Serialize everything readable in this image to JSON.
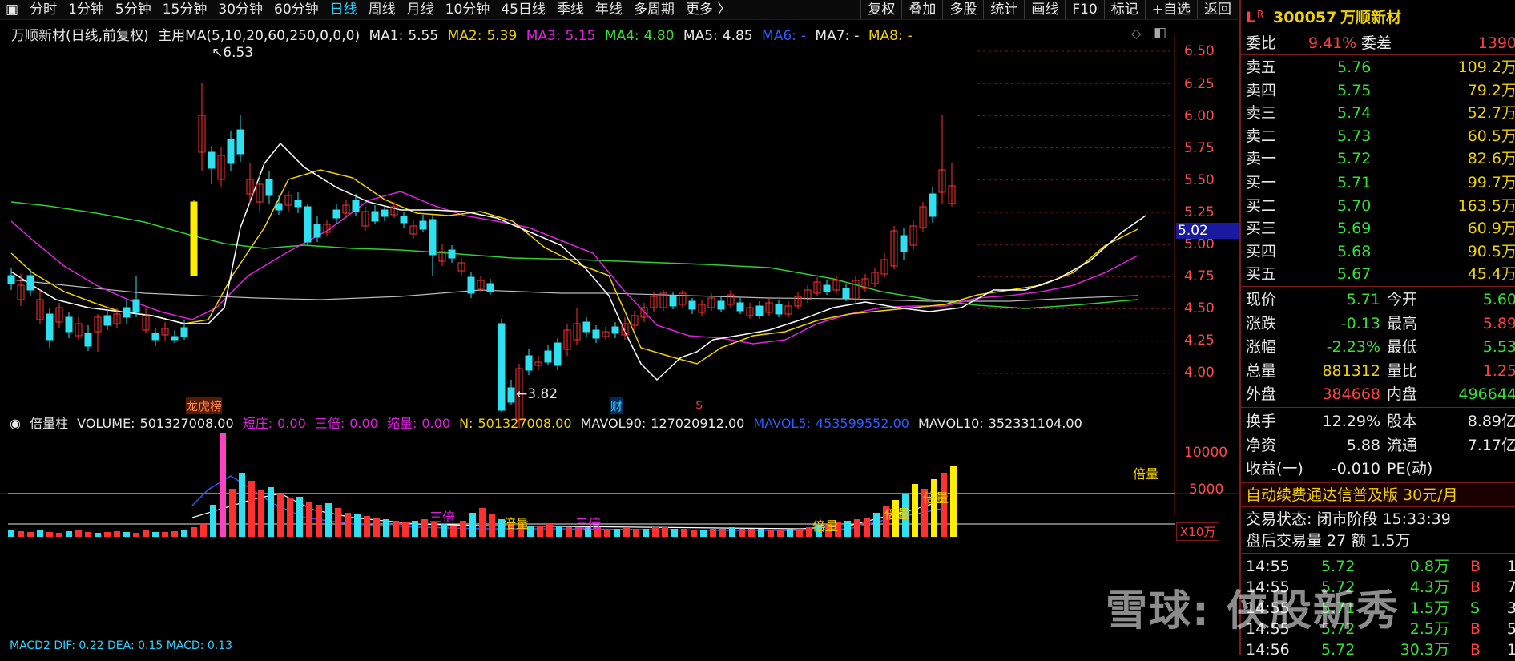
{
  "toolbar": {
    "periods": [
      "分时",
      "1分钟",
      "5分钟",
      "15分钟",
      "30分钟",
      "60分钟",
      "日线",
      "周线",
      "月线",
      "10分钟",
      "45日线",
      "季线",
      "年线",
      "多周期",
      "更多 〉"
    ],
    "active": "日线",
    "right_buttons": [
      "复权",
      "叠加",
      "多股",
      "统计",
      "画线",
      "F10",
      "标记",
      "+自选",
      "返回"
    ]
  },
  "main_header": {
    "stock_mode": "万顺新材(日线,前复权)",
    "indicator_name": "主用MA(5,10,20,60,250,0,0,0)",
    "ma": [
      {
        "label": "MA1:",
        "value": "5.55",
        "color": "#e8e8e8"
      },
      {
        "label": "MA2:",
        "value": "5.39",
        "color": "#f0d000"
      },
      {
        "label": "MA3:",
        "value": "5.15",
        "color": "#e020e0"
      },
      {
        "label": "MA4:",
        "value": "4.80",
        "color": "#35e035"
      },
      {
        "label": "MA5:",
        "value": "4.85",
        "color": "#e8e8e8"
      },
      {
        "label": "MA6:",
        "value": "-",
        "color": "#2a5cff"
      },
      {
        "label": "MA7:",
        "value": "-",
        "color": "#e8e8e8"
      },
      {
        "label": "MA8:",
        "value": "-",
        "color": "#f0d000"
      }
    ]
  },
  "price_axis": [
    "6.50",
    "6.25",
    "6.00",
    "5.75",
    "5.50",
    "5.25",
    "5.00",
    "4.75",
    "4.50",
    "4.25",
    "4.00"
  ],
  "current_price_tag": "5.02",
  "annotations": {
    "high": "6.53",
    "low": "3.82",
    "markers": [
      "龙虎榜",
      "财",
      "$"
    ]
  },
  "volume_header": {
    "name": "倍量柱",
    "items": [
      {
        "label": "VOLUME:",
        "value": "501327008.00",
        "color": "#e8e8e8"
      },
      {
        "label": "短庄:",
        "value": "0.00",
        "color": "#e020e0"
      },
      {
        "label": "三倍:",
        "value": "0.00",
        "color": "#e020e0"
      },
      {
        "label": "缩量:",
        "value": "0.00",
        "color": "#e020e0"
      },
      {
        "label": "N:",
        "value": "501327008.00",
        "color": "#f0d000"
      },
      {
        "label": "MAVOL90:",
        "value": "127020912.00",
        "color": "#e8e8e8"
      },
      {
        "label": "MAVOL5:",
        "value": "453599552.00",
        "color": "#2a5cff"
      },
      {
        "label": "MAVOL10:",
        "value": "352331104.00",
        "color": "#e8e8e8"
      }
    ]
  },
  "volume_axis": [
    "10000",
    "5000"
  ],
  "volume_unit": "X10万",
  "volume_labels": [
    "倍量",
    "三倍",
    "倍量",
    "三倍",
    "倍量",
    "倍量",
    "倍量"
  ],
  "macd_header": "MACD2 DIF: 0.22 DEA: 0.15 MACD: 0.13",
  "quote": {
    "title_prefix": "L",
    "title_sup": "R",
    "code": "300057",
    "name": "万顺新材",
    "weibi_label": "委比",
    "weibi": "9.41%",
    "weicha_label": "委差",
    "weicha": "1390",
    "asks": [
      {
        "label": "卖五",
        "price": "5.76",
        "vol": "109.2万"
      },
      {
        "label": "卖四",
        "price": "5.75",
        "vol": "79.2万"
      },
      {
        "label": "卖三",
        "price": "5.74",
        "vol": "52.7万"
      },
      {
        "label": "卖二",
        "price": "5.73",
        "vol": "60.5万"
      },
      {
        "label": "卖一",
        "price": "5.72",
        "vol": "82.6万"
      }
    ],
    "bids": [
      {
        "label": "买一",
        "price": "5.71",
        "vol": "99.7万"
      },
      {
        "label": "买二",
        "price": "5.70",
        "vol": "163.5万"
      },
      {
        "label": "买三",
        "price": "5.69",
        "vol": "60.9万"
      },
      {
        "label": "买四",
        "price": "5.68",
        "vol": "90.5万"
      },
      {
        "label": "买五",
        "price": "5.67",
        "vol": "45.4万"
      }
    ],
    "stats": [
      {
        "l1": "现价",
        "v1": "5.71",
        "c1": "green",
        "l2": "今开",
        "v2": "5.60",
        "c2": "green"
      },
      {
        "l1": "涨跌",
        "v1": "-0.13",
        "c1": "green",
        "l2": "最高",
        "v2": "5.89",
        "c2": "red"
      },
      {
        "l1": "涨幅",
        "v1": "-2.23%",
        "c1": "green",
        "l2": "最低",
        "v2": "5.53",
        "c2": "green"
      },
      {
        "l1": "总量",
        "v1": "881312",
        "c1": "yellow",
        "l2": "量比",
        "v2": "1.25",
        "c2": "red"
      },
      {
        "l1": "外盘",
        "v1": "384668",
        "c1": "red",
        "l2": "内盘",
        "v2": "496644",
        "c2": "green"
      }
    ],
    "stats2": [
      {
        "l1": "换手",
        "v1": "12.29%",
        "c1": "white",
        "l2": "股本",
        "v2": "8.89亿",
        "c2": "white"
      },
      {
        "l1": "净资",
        "v1": "5.88",
        "c1": "white",
        "l2": "流通",
        "v2": "7.17亿",
        "c2": "white"
      },
      {
        "l1": "收益(一)",
        "v1": "-0.010",
        "c1": "white",
        "l2": "PE(动)",
        "v2": "",
        "c2": "white"
      }
    ],
    "promo": "自动续费通达信普及版  30元/月",
    "trade_state": "交易状态: 闭市阶段 15:33:39",
    "after_hours": "盘后交易量 27 额 1.5万",
    "ticks": [
      {
        "time": "14:55",
        "price": "5.72",
        "vol": "0.8万",
        "bs": "B",
        "n": "1"
      },
      {
        "time": "14:55",
        "price": "5.72",
        "vol": "4.3万",
        "bs": "B",
        "n": "7"
      },
      {
        "time": "14:55",
        "price": "5.71",
        "vol": "1.5万",
        "bs": "S",
        "n": "3"
      },
      {
        "time": "14:55",
        "price": "5.72",
        "vol": "2.5万",
        "bs": "B",
        "n": "5"
      },
      {
        "time": "14:56",
        "price": "5.72",
        "vol": "30.3万",
        "bs": "B",
        "n": "1"
      }
    ]
  },
  "watermark": "雪球: 侠股新秀",
  "chart_data": {
    "type": "candlestick",
    "ylim": [
      3.8,
      6.6
    ],
    "note_high": 6.53,
    "note_low": 3.82
  }
}
